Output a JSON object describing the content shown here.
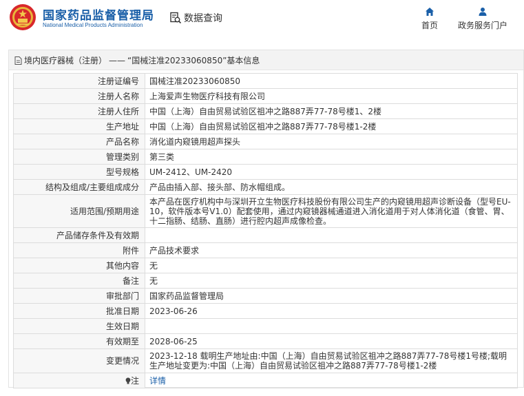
{
  "header": {
    "brand_cn": "国家药品监督管理局",
    "brand_en": "National Medical Products Administration",
    "query_label": "数据查询",
    "nav": [
      {
        "label": "首页",
        "icon": "home-icon"
      },
      {
        "label": "政务服务门户",
        "icon": "user-icon"
      }
    ],
    "brand_color": "#1a5fa8"
  },
  "breadcrumb": {
    "category": "境内医疗器械（注册）",
    "separator": "——",
    "title": "“国械注准20233060850”基本信息"
  },
  "rows": [
    {
      "label": "注册证编号",
      "value": "国械注准20233060850"
    },
    {
      "label": "注册人名称",
      "value": "上海爱声生物医疗科技有限公司"
    },
    {
      "label": "注册人住所",
      "value": "中国（上海）自由贸易试验区祖冲之路887弄77-78号楼1、2楼"
    },
    {
      "label": "生产地址",
      "value": "中国（上海）自由贸易试验区祖冲之路887弄77-78号楼1-2楼"
    },
    {
      "label": "产品名称",
      "value": "消化道内窥镜用超声探头"
    },
    {
      "label": "管理类别",
      "value": "第三类"
    },
    {
      "label": "型号规格",
      "value": "UM-2412、UM-2420"
    },
    {
      "label": "结构及组成/主要组成成分",
      "value": "产品由插入部、接头部、防水帽组成。"
    },
    {
      "label": "适用范围/预期用途",
      "value": "本产品在医疗机构中与深圳开立生物医疗科技股份有限公司生产的内窥镜用超声诊断设备（型号EU-10，软件版本号V1.0）配套使用，通过内窥镜器械通道进入消化道用于对人体消化道（食管、胃、十二指肠、结肠、直肠）进行腔内超声成像检查。"
    },
    {
      "label": "产品储存条件及有效期",
      "value": ""
    },
    {
      "label": "附件",
      "value": "产品技术要求"
    },
    {
      "label": "其他内容",
      "value": "无"
    },
    {
      "label": "备注",
      "value": "无"
    },
    {
      "label": "审批部门",
      "value": "国家药品监督管理局"
    },
    {
      "label": "批准日期",
      "value": "2023-06-26"
    },
    {
      "label": "生效日期",
      "value": ""
    },
    {
      "label": "有效期至",
      "value": "2028-06-25"
    },
    {
      "label": "变更情况",
      "value": "2023-12-18 载明生产地址由:中国（上海）自由贸易试验区祖冲之路887弄77-78号楼1号楼;载明生产地址变更为:中国（上海）自由贸易试验区祖冲之路887弄77-78号楼1-2楼"
    },
    {
      "label": "注",
      "value": "详情",
      "icon": "bulb-icon"
    }
  ]
}
